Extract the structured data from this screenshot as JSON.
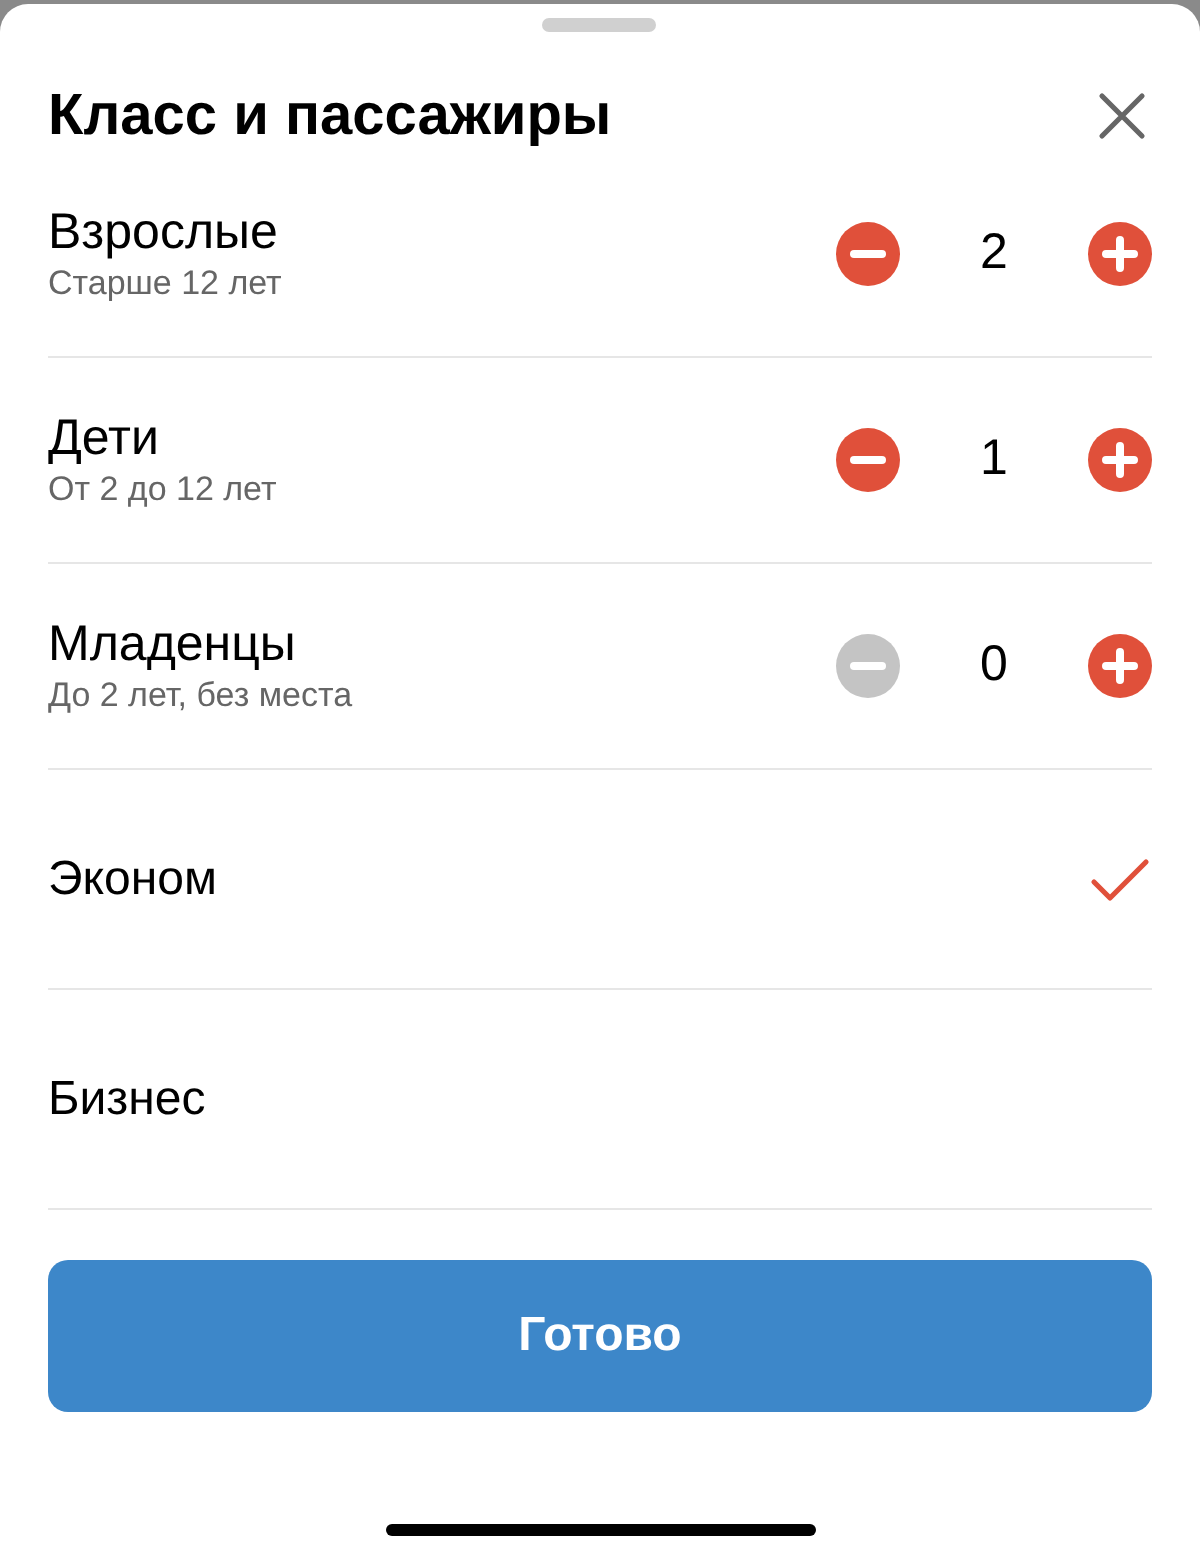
{
  "title": "Класс и пассажиры",
  "passengers": [
    {
      "label": "Взрослые",
      "hint": "Старше 12 лет",
      "count": "2",
      "minus_disabled": false
    },
    {
      "label": "Дети",
      "hint": "От 2 до 12 лет",
      "count": "1",
      "minus_disabled": false
    },
    {
      "label": "Младенцы",
      "hint": "До 2 лет, без места",
      "count": "0",
      "minus_disabled": true
    }
  ],
  "classes": [
    {
      "label": "Эконом",
      "selected": true
    },
    {
      "label": "Бизнес",
      "selected": false
    }
  ],
  "done_button": "Готово"
}
